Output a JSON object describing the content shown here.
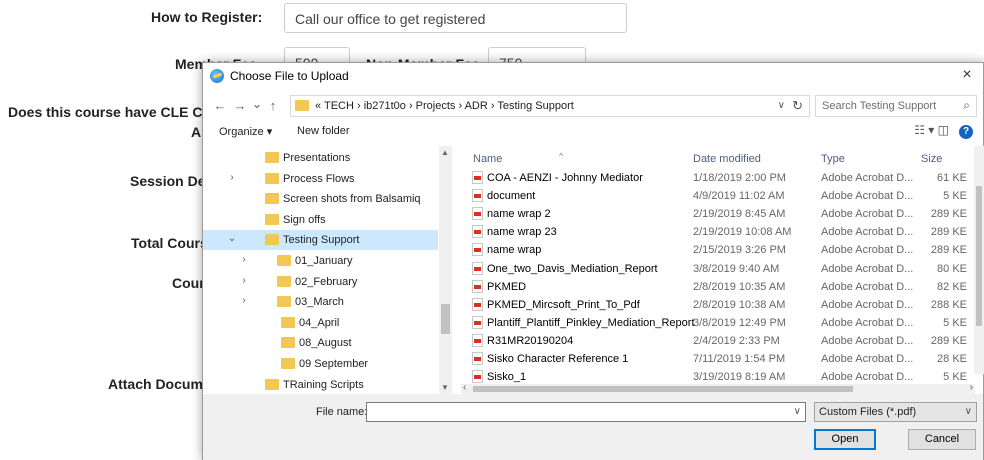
{
  "form": {
    "how_register_label": "How to Register:",
    "how_register_value": "Call our office to get registered",
    "member_fee_label": "Member Fee:",
    "member_fee_value": "500",
    "nonmember_fee_label": "Non-Member Fee:",
    "nonmember_fee_value": "750",
    "cle_label": "Does this course have CLE Cor",
    "a_label": "A",
    "session_label": "Session Des",
    "total_label": "Total Cours",
    "course_label": "Cours",
    "attach_label": "Attach Docume"
  },
  "dialog": {
    "title": "Choose File to Upload",
    "close": "×",
    "nav": {
      "back": "←",
      "forward": "→",
      "recent": "⌄",
      "up": "↑"
    },
    "address_crumbs": "«  TECH  ›  ib271t0o  ›  Projects  ›  ADR  ›  Testing Support",
    "address_dropdown": "∨",
    "refresh": "↻",
    "search_placeholder": "Search Testing Support",
    "search_icon": "⌕",
    "organize": "Organize ▾",
    "new_folder": "New folder",
    "view_icons": "☷ ▾   ◫",
    "help": "?",
    "tree": [
      {
        "label": "Presentations",
        "chev": ""
      },
      {
        "label": "Process Flows",
        "chev": "›"
      },
      {
        "label": "Screen shots from Balsamiq",
        "chev": ""
      },
      {
        "label": "Sign offs",
        "chev": ""
      },
      {
        "label": "Testing Support",
        "chev": "⌄"
      },
      {
        "label": "01_January",
        "chev": "›"
      },
      {
        "label": "02_February",
        "chev": "›"
      },
      {
        "label": "03_March",
        "chev": "›"
      },
      {
        "label": "04_April",
        "chev": ""
      },
      {
        "label": "08_August",
        "chev": ""
      },
      {
        "label": "09 September",
        "chev": ""
      },
      {
        "label": "TRaining Scripts",
        "chev": ""
      }
    ],
    "columns": {
      "name": "Name",
      "date": "Date modified",
      "type": "Type",
      "size": "Size"
    },
    "files": [
      {
        "name": "COA - AENZI - Johnny Mediator",
        "date": "1/18/2019 2:00 PM",
        "type": "Adobe Acrobat D...",
        "size": "61 KE"
      },
      {
        "name": "document",
        "date": "4/9/2019 11:02 AM",
        "type": "Adobe Acrobat D...",
        "size": "5 KE"
      },
      {
        "name": "name wrap 2",
        "date": "2/19/2019 8:45 AM",
        "type": "Adobe Acrobat D...",
        "size": "289 KE"
      },
      {
        "name": "name wrap 23",
        "date": "2/19/2019 10:08 AM",
        "type": "Adobe Acrobat D...",
        "size": "289 KE"
      },
      {
        "name": "name wrap",
        "date": "2/15/2019 3:26 PM",
        "type": "Adobe Acrobat D...",
        "size": "289 KE"
      },
      {
        "name": "One_two_Davis_Mediation_Report",
        "date": "3/8/2019 9:40 AM",
        "type": "Adobe Acrobat D...",
        "size": "80 KE"
      },
      {
        "name": "PKMED",
        "date": "2/8/2019 10:35 AM",
        "type": "Adobe Acrobat D...",
        "size": "82 KE"
      },
      {
        "name": "PKMED_Mircsoft_Print_To_Pdf",
        "date": "2/8/2019 10:38 AM",
        "type": "Adobe Acrobat D...",
        "size": "288 KE"
      },
      {
        "name": "Plantiff_Plantiff_Pinkley_Mediation_Report",
        "date": "3/8/2019 12:49 PM",
        "type": "Adobe Acrobat D...",
        "size": "5 KE"
      },
      {
        "name": "R31MR20190204",
        "date": "2/4/2019 2:33 PM",
        "type": "Adobe Acrobat D...",
        "size": "289 KE"
      },
      {
        "name": "Sisko Character Reference 1",
        "date": "7/11/2019 1:54 PM",
        "type": "Adobe Acrobat D...",
        "size": "28 KE"
      },
      {
        "name": "Sisko_1",
        "date": "3/19/2019 8:19 AM",
        "type": "Adobe Acrobat D...",
        "size": "5 KE"
      }
    ],
    "file_name_label": "File name:",
    "file_name_value": "",
    "filter": "Custom Files (*.pdf)",
    "open": "Open",
    "cancel": "Cancel",
    "dropdown_arrow": "∨",
    "selected_folder_color": "#cce8ff",
    "folder_color": "#f3c754"
  }
}
